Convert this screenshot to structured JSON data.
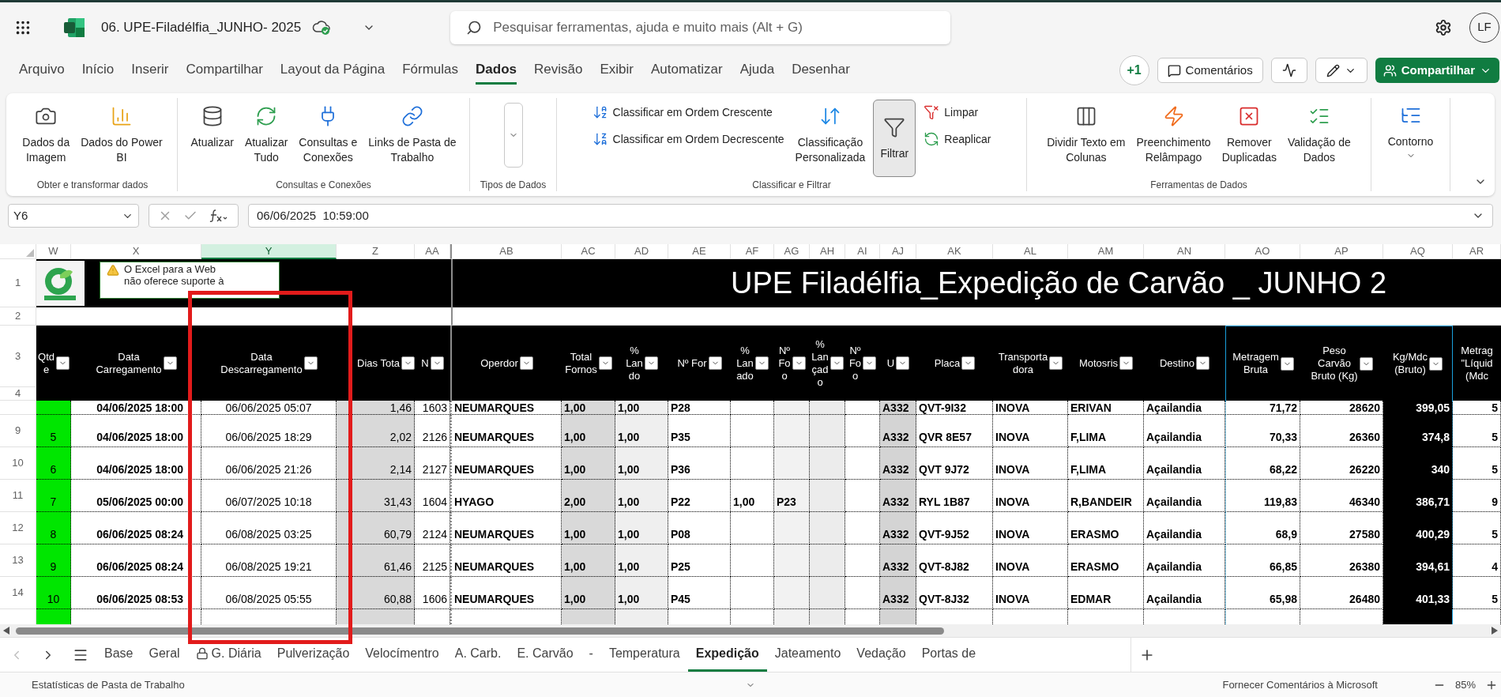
{
  "app_bar": {
    "file_name": "06. UPE-Filadélfia_JUNHO- 2025",
    "search_placeholder": "Pesquisar ferramentas, ajuda e muito mais (Alt + G)",
    "avatar": "LF"
  },
  "menu_tabs": [
    {
      "label": "Arquivo",
      "selected": false
    },
    {
      "label": "Início",
      "selected": false
    },
    {
      "label": "Inserir",
      "selected": false
    },
    {
      "label": "Compartilhar",
      "selected": false
    },
    {
      "label": "Layout da Página",
      "selected": false
    },
    {
      "label": "Fórmulas",
      "selected": false
    },
    {
      "label": "Dados",
      "selected": true
    },
    {
      "label": "Revisão",
      "selected": false
    },
    {
      "label": "Exibir",
      "selected": false
    },
    {
      "label": "Automatizar",
      "selected": false
    },
    {
      "label": "Ajuda",
      "selected": false
    },
    {
      "label": "Desenhar",
      "selected": false
    }
  ],
  "actions": {
    "presence": "+1",
    "comments": "Comentários",
    "share": "Compartilhar"
  },
  "ribbon": {
    "groups": [
      {
        "label": "Obter e transformar dados",
        "items": [
          {
            "kind": "large",
            "label": "Dados da\nImagem",
            "pressed": false
          },
          {
            "kind": "large",
            "label": "Dados do Power\nBI",
            "pressed": false
          }
        ]
      },
      {
        "label": "Consultas e Conexões",
        "items": [
          {
            "kind": "large",
            "label": "Atualizar",
            "pressed": false
          },
          {
            "kind": "large",
            "label": "Atualizar\nTudo",
            "pressed": false
          },
          {
            "kind": "large",
            "label": "Consultas e\nConexões",
            "pressed": false
          },
          {
            "kind": "large",
            "label": "Links de Pasta de\nTrabalho",
            "pressed": false
          }
        ]
      },
      {
        "label": "Tipos de Dados",
        "items": [
          {
            "kind": "gallery"
          }
        ]
      },
      {
        "label": "Classificar e Filtrar",
        "items": [
          {
            "kind": "stack",
            "buttons": [
              "Classificar em Ordem Crescente",
              "Classificar em Ordem Decrescente"
            ]
          },
          {
            "kind": "large",
            "label": "Classificação\nPersonalizada",
            "pressed": false
          },
          {
            "kind": "large",
            "label": "Filtrar",
            "pressed": true
          },
          {
            "kind": "stack",
            "buttons": [
              "Limpar",
              "Reaplicar"
            ]
          }
        ]
      },
      {
        "label": "Ferramentas de Dados",
        "items": [
          {
            "kind": "large",
            "label": "Dividir Texto em\nColunas",
            "pressed": false
          },
          {
            "kind": "large",
            "label": "Preenchimento\nRelâmpago",
            "pressed": false
          },
          {
            "kind": "large",
            "label": "Remover\nDuplicadas",
            "pressed": false
          },
          {
            "kind": "large",
            "label": "Validação de\nDados",
            "pressed": false
          }
        ]
      },
      {
        "items": [
          {
            "kind": "menu",
            "label": "Contorno"
          }
        ]
      }
    ]
  },
  "formula_bar": {
    "name_box": "Y6",
    "value": "06/06/2025  10:59:00"
  },
  "sheet": {
    "columns": [
      {
        "label": "W",
        "selected": false
      },
      {
        "label": "X",
        "selected": false
      },
      {
        "label": "Y",
        "selected": true
      },
      {
        "label": "Z",
        "selected": false
      },
      {
        "label": "AA",
        "selected": false
      },
      {
        "label": "AB",
        "selected": false
      },
      {
        "label": "AC",
        "selected": false
      },
      {
        "label": "AD",
        "selected": false
      },
      {
        "label": "AE",
        "selected": false
      },
      {
        "label": "AF",
        "selected": false
      },
      {
        "label": "AG",
        "selected": false
      },
      {
        "label": "AH",
        "selected": false
      },
      {
        "label": "AI",
        "selected": false
      },
      {
        "label": "AJ",
        "selected": false
      },
      {
        "label": "AK",
        "selected": false
      },
      {
        "label": "AL",
        "selected": false
      },
      {
        "label": "AM",
        "selected": false
      },
      {
        "label": "AN",
        "selected": false
      },
      {
        "label": "AO",
        "selected": false
      },
      {
        "label": "AP",
        "selected": false
      },
      {
        "label": "AQ",
        "selected": false
      },
      {
        "label": "AR",
        "selected": false
      }
    ],
    "banner_rows": [
      "1",
      "2"
    ],
    "title": "UPE Filadélfia_Expedição de Carvão _ JUNHO 2",
    "notice": "O Excel para a Web\nnão oferece suporte à",
    "header_rows": [
      "3",
      "4"
    ],
    "headers": [
      {
        "label": "Qtd\ne",
        "filter": true
      },
      {
        "label": "Data\nCarregamento",
        "filter": true
      },
      {
        "label": "Data\nDescarregamento",
        "filter": true
      },
      {
        "label": "Dias Tota",
        "filter": true
      },
      {
        "label": "N",
        "filter": true
      },
      {
        "label": "Operdor",
        "filter": true
      },
      {
        "label": "Total\nFornos",
        "filter": true
      },
      {
        "label": "%\nLan\ndo",
        "filter": true
      },
      {
        "label": "Nº For",
        "filter": true
      },
      {
        "label": "%\nLan\nado",
        "filter": true
      },
      {
        "label": "Nº\nFo\no",
        "filter": true
      },
      {
        "label": "%\nLan\nçad\no",
        "filter": true
      },
      {
        "label": "Nº\nFo\no",
        "filter": true
      },
      {
        "label": "U",
        "filter": true
      },
      {
        "label": "Placa",
        "filter": true
      },
      {
        "label": "Transporta\ndora",
        "filter": true
      },
      {
        "label": "Motosris",
        "filter": true
      },
      {
        "label": "Destino",
        "filter": true
      },
      {
        "label": "Metragem\nBruta",
        "filter": true
      },
      {
        "label": "Peso\nCarvão\nBruto (Kg)",
        "filter": true
      },
      {
        "label": "Kg/Mdc\n(Bruto)",
        "filter": true
      },
      {
        "label": "Metrag\n\"Líquid\n(Mdc",
        "filter": false
      }
    ],
    "rows": [
      {
        "kind": "partial",
        "cells": [
          null,
          "04/06/2025 18:00",
          "06/06/2025 05:07",
          "1,46",
          "1603",
          "NEUMARQUES",
          "1,00",
          "1,00",
          "P28",
          null,
          null,
          null,
          null,
          "A332",
          "QVT-9I32",
          "INOVA",
          "ERIVAN",
          "Açailandia",
          "71,72",
          "28620",
          "399,05",
          "5"
        ]
      },
      {
        "kind": "full",
        "number": "9",
        "cells": [
          "5",
          "04/06/2025 18:00",
          "06/06/2025 18:29",
          "2,02",
          "2126",
          "NEUMARQUES",
          "1,00",
          "1,00",
          "P35",
          null,
          null,
          null,
          null,
          "A332",
          "QVR 8E57",
          "INOVA",
          "F,LIMA",
          "Açailandia",
          "70,33",
          "26360",
          "374,8",
          "5"
        ]
      },
      {
        "kind": "full",
        "number": "10",
        "cells": [
          "6",
          "04/06/2025 18:00",
          "06/06/2025 21:26",
          "2,14",
          "2127",
          "NEUMARQUES",
          "1,00",
          "1,00",
          "P36",
          null,
          null,
          null,
          null,
          "A332",
          "QVT 9J72",
          "INOVA",
          "F,LIMA",
          "Açailandia",
          "68,22",
          "26220",
          "340",
          "5"
        ]
      },
      {
        "kind": "full",
        "number": "11",
        "cells": [
          "7",
          "05/06/2025 00:00",
          "06/07/2025 10:18",
          "31,43",
          "1604",
          "HYAGO",
          "2,00",
          "1,00",
          "P22",
          "1,00",
          "P23",
          null,
          null,
          "A332",
          "RYL 1B87",
          "INOVA",
          "R,BANDEIR",
          "Açailandia",
          "119,83",
          "46340",
          "386,71",
          "9"
        ]
      },
      {
        "kind": "full",
        "number": "12",
        "cells": [
          "8",
          "06/06/2025 08:24",
          "06/08/2025 03:25",
          "60,79",
          "2124",
          "NEUMARQUES",
          "1,00",
          "1,00",
          "P08",
          null,
          null,
          null,
          null,
          "A332",
          "QVT-9J52",
          "INOVA",
          "ERASMO",
          "Açailandia",
          "68,9",
          "27580",
          "400,29",
          "5"
        ]
      },
      {
        "kind": "full",
        "number": "13",
        "cells": [
          "9",
          "06/06/2025 08:24",
          "06/08/2025 19:21",
          "61,46",
          "2125",
          "NEUMARQUES",
          "1,00",
          "1,00",
          "P25",
          null,
          null,
          null,
          null,
          "A332",
          "QVT-8J82",
          "INOVA",
          "ERASMO",
          "Açailandia",
          "66,85",
          "26380",
          "394,61",
          "4"
        ]
      },
      {
        "kind": "full",
        "number": "14",
        "cells": [
          "10",
          "06/06/2025 08:53",
          "06/08/2025 05:55",
          "60,88",
          "1606",
          "NEUMARQUES",
          "1,00",
          "1,00",
          "P45",
          null,
          null,
          null,
          null,
          "A332",
          "QVT-8J32",
          "INOVA",
          "EDMAR",
          "Açailandia",
          "65,98",
          "26480",
          "401,33",
          "5"
        ]
      }
    ]
  },
  "sheet_tabs": [
    {
      "label": "Base",
      "selected": false,
      "locked": false
    },
    {
      "label": "Geral",
      "selected": false,
      "locked": false
    },
    {
      "label": "G. Diária",
      "selected": false,
      "locked": true
    },
    {
      "label": "Pulverização",
      "selected": false,
      "locked": false
    },
    {
      "label": "Velocímentro",
      "selected": false,
      "locked": false
    },
    {
      "label": "A. Carb.",
      "selected": false,
      "locked": false
    },
    {
      "label": "E. Carvão",
      "selected": false,
      "locked": false
    },
    {
      "label": "-",
      "selected": false,
      "locked": false
    },
    {
      "label": "Temperatura",
      "selected": false,
      "locked": false
    },
    {
      "label": "Expedição",
      "selected": true,
      "locked": false
    },
    {
      "label": "Jateamento",
      "selected": false,
      "locked": false
    },
    {
      "label": "Vedação",
      "selected": false,
      "locked": false
    },
    {
      "label": "Portas de",
      "selected": false,
      "locked": false
    }
  ],
  "status_bar": {
    "left": "Estatísticas de Pasta de Trabalho",
    "feedback": "Fornecer Comentários à Microsoft",
    "zoom": "85%"
  }
}
